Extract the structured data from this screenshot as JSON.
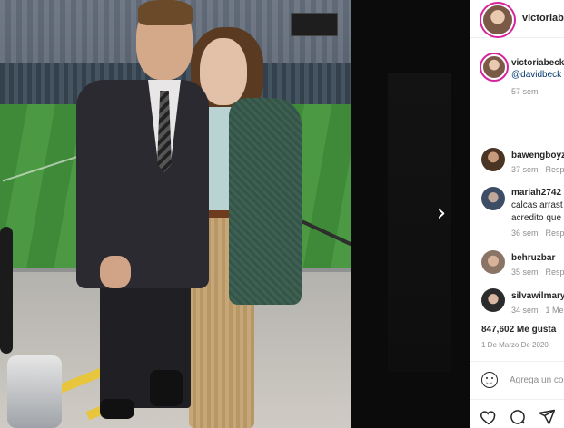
{
  "post": {
    "username": "victoriabe",
    "next_label": "›"
  },
  "caption": {
    "username": "victoriabeck",
    "mention": "@davidbeck",
    "time": "57 sem"
  },
  "comments": [
    {
      "username": "bawengboyz",
      "text": "",
      "time": "37 sem",
      "reply": "Resp"
    },
    {
      "username": "mariah2742",
      "text": "calcas arrast",
      "text2": "acredito que",
      "time": "36 sem",
      "reply": "Resp"
    },
    {
      "username": "behruzbar",
      "text": "",
      "time": "35 sem",
      "reply": "Resp"
    },
    {
      "username": "silvawilmary",
      "text": "",
      "time": "34 sem",
      "reply": "1 Me"
    }
  ],
  "likes": "847,602 Me gusta",
  "date": "1 De Marzo De 2020",
  "comment_box": {
    "placeholder": "Agrega un co"
  },
  "icons": {
    "like": "heart-icon",
    "comment": "comment-icon",
    "share": "send-icon",
    "emoji": "emoji-icon"
  },
  "colors": {
    "story_ring": "#d6249f",
    "link": "#00376b",
    "muted": "#8e8e8e",
    "text": "#262626"
  }
}
